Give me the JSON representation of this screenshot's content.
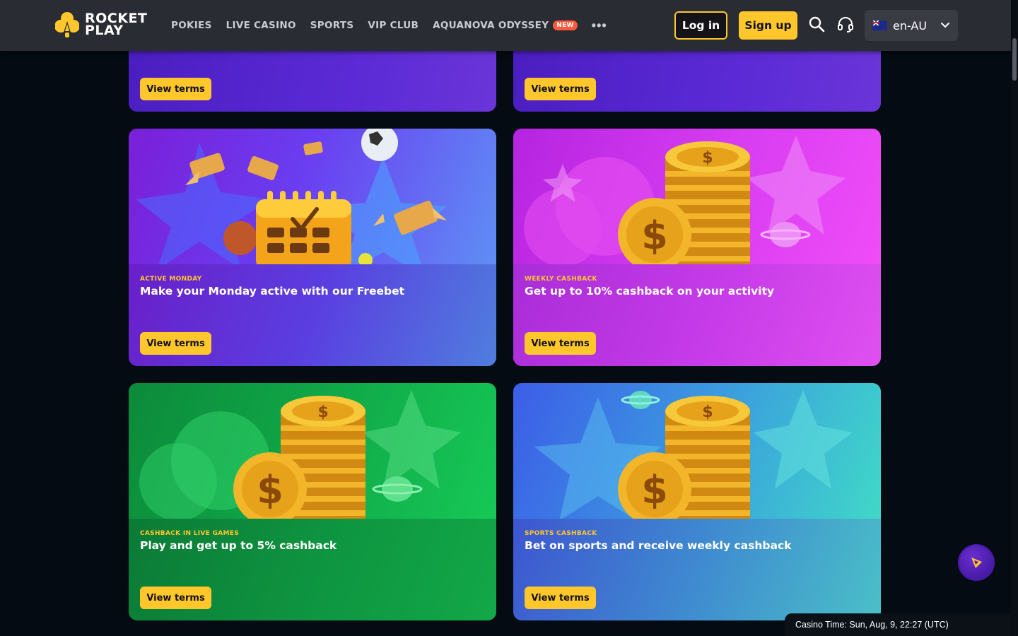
{
  "header": {
    "logo_line1": "ROCKET",
    "logo_line2": "PLAY",
    "nav": [
      {
        "label": "POKIES"
      },
      {
        "label": "LIVE CASINO"
      },
      {
        "label": "SPORTS"
      },
      {
        "label": "VIP CLUB"
      },
      {
        "label": "AQUANOVA ODYSSEY",
        "badge": "NEW"
      }
    ],
    "more_label": "•••",
    "login_label": "Log in",
    "signup_label": "Sign up",
    "search_icon": "search-icon",
    "support_icon": "headset-icon",
    "language": "en-AU"
  },
  "top_cards": [
    {
      "button": "View terms"
    },
    {
      "button": "View terms"
    }
  ],
  "cards": [
    {
      "tag": "ACTIVE MONDAY",
      "title": "Make your Monday active with our Freebet",
      "button": "View terms"
    },
    {
      "tag": "WEEKLY CASHBACK",
      "title": "Get up to 10% cashback on your activity",
      "button": "View terms"
    },
    {
      "tag": "CASHBACK IN LIVE GAMES",
      "title": "Play and get up to 5% cashback",
      "button": "View terms"
    },
    {
      "tag": "SPORTS CASHBACK",
      "title": "Bet on sports and receive weekly cashback",
      "button": "View terms"
    }
  ],
  "casino_time": "Casino Time: Sun, Aug, 9, 22:27 (UTC)",
  "colors": {
    "accent": "#ffc72c",
    "header_bg": "#2a2c33",
    "page_bg": "#050b12"
  }
}
